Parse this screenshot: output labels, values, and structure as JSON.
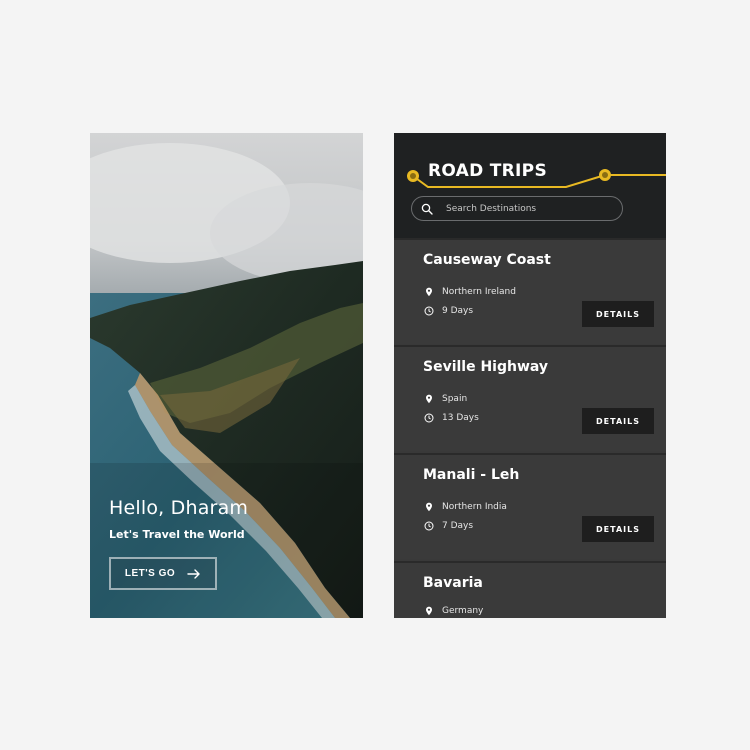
{
  "welcome": {
    "greeting": "Hello, Dharam",
    "tagline": "Let's Travel the World",
    "cta_label": "LET'S GO"
  },
  "road_trips": {
    "title": "ROAD TRIPS",
    "search_placeholder": "Search Destinations",
    "accent_color": "#e8b923",
    "details_label": "DETAILS",
    "trips": [
      {
        "name": "Causeway Coast",
        "location": "Northern Ireland",
        "duration": "9 Days"
      },
      {
        "name": "Seville Highway",
        "location": "Spain",
        "duration": "13 Days"
      },
      {
        "name": "Manali - Leh",
        "location": "Northern India",
        "duration": "7 Days"
      },
      {
        "name": "Bavaria",
        "location": "Germany"
      }
    ]
  }
}
